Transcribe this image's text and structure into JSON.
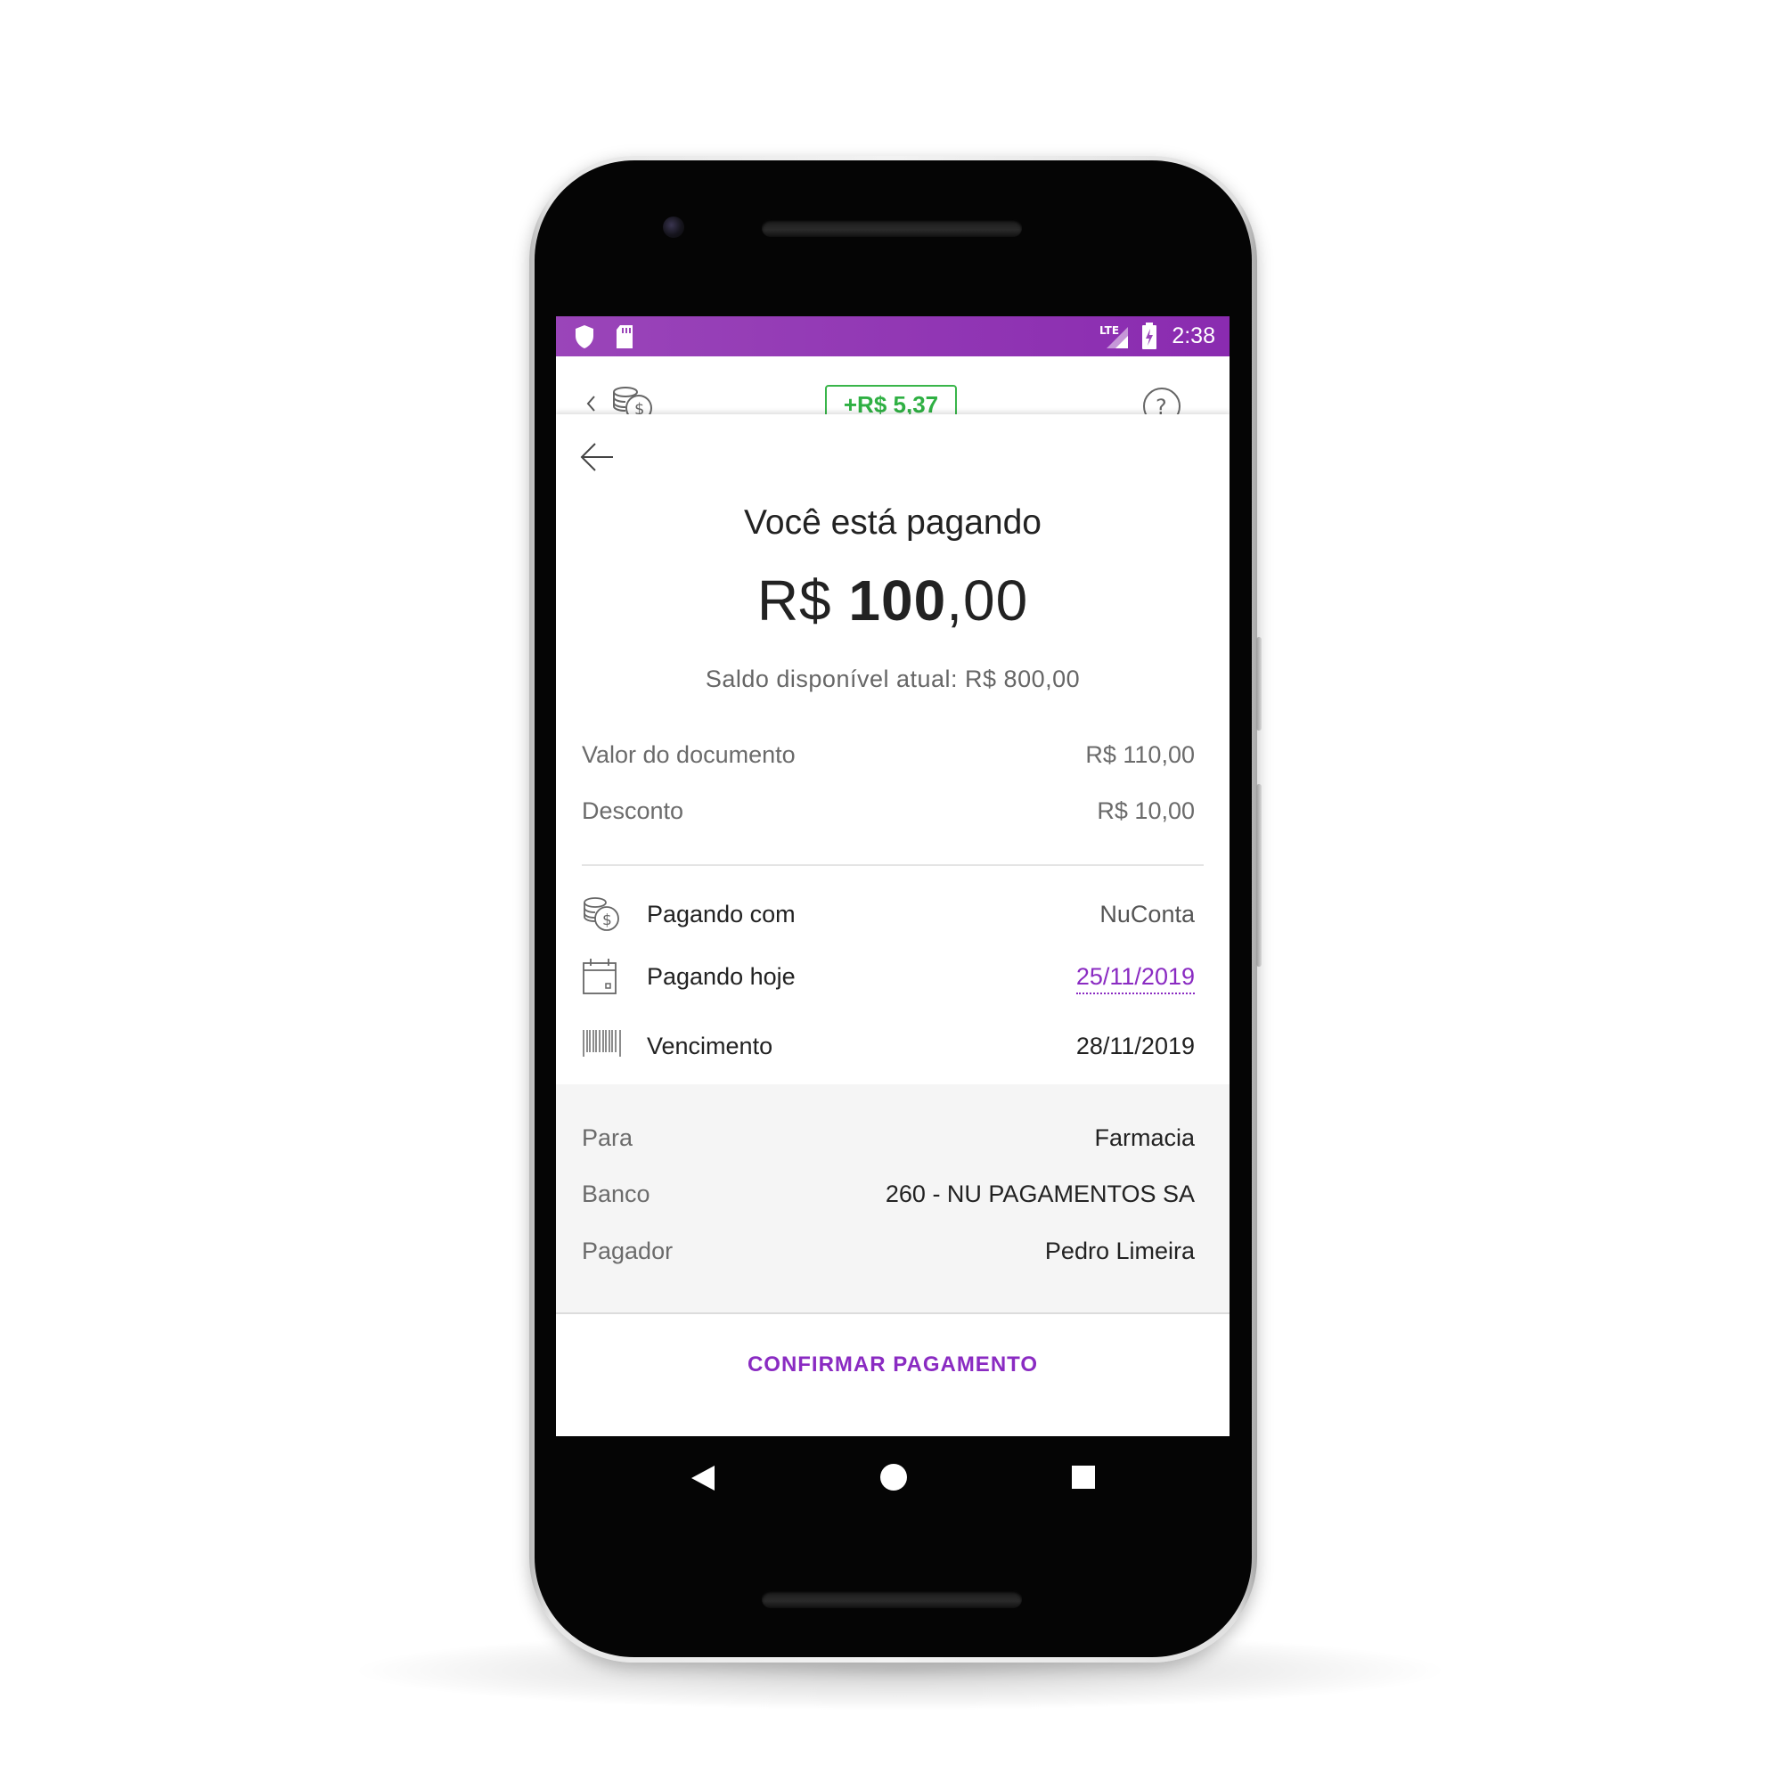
{
  "status_bar": {
    "network": "LTE",
    "time": "2:38",
    "icons": [
      "shield-icon",
      "sd-card-icon",
      "lte-signal-icon",
      "battery-charging-icon"
    ]
  },
  "header": {
    "badge": "+R$ 5,37",
    "icons": [
      "chevron-left-icon",
      "coins-icon",
      "help-icon"
    ]
  },
  "payment": {
    "title": "Você está pagando",
    "amount_currency": "R$",
    "amount_integer": "100",
    "amount_decimal": ",00",
    "balance": "Saldo disponível atual: R$ 800,00",
    "summary": [
      {
        "label": "Valor do documento",
        "value": "R$ 110,00"
      },
      {
        "label": "Desconto",
        "value": "R$ 10,00"
      }
    ],
    "info": [
      {
        "icon": "coins-icon",
        "label": "Pagando com",
        "value": "NuConta"
      },
      {
        "icon": "calendar-icon",
        "label": "Pagando hoje",
        "value": "25/11/2019"
      },
      {
        "icon": "barcode-icon",
        "label": "Vencimento",
        "value": "28/11/2019"
      }
    ],
    "details": [
      {
        "label": "Para",
        "value": "Farmacia"
      },
      {
        "label": "Banco",
        "value": "260 - NU PAGAMENTOS SA"
      },
      {
        "label": "Pagador",
        "value": "Pedro Limeira"
      }
    ],
    "confirm_label": "CONFIRMAR PAGAMENTO"
  },
  "nav": {
    "icons": [
      "back-triangle-icon",
      "home-circle-icon",
      "recents-square-icon"
    ]
  },
  "colors": {
    "accent": "#8a2bc2",
    "status_bar": "#9a45b9",
    "badge_green": "#2fb043",
    "details_bg": "#f5f5f5"
  }
}
